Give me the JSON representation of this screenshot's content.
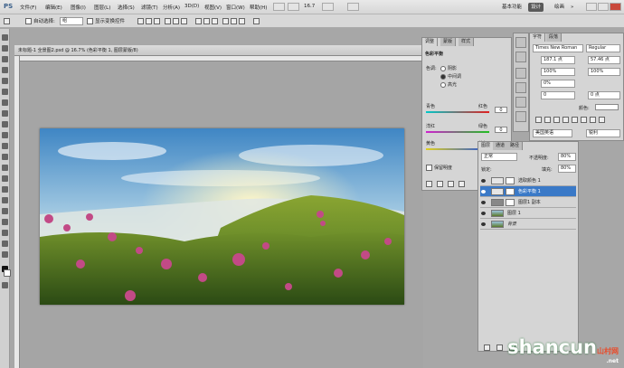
{
  "app": {
    "logo": "PS"
  },
  "menu": [
    "文件(F)",
    "编辑(E)",
    "图像(I)",
    "图层(L)",
    "选择(S)",
    "滤镜(T)",
    "分析(A)",
    "3D(D)",
    "视图(V)",
    "窗口(W)",
    "帮助(H)"
  ],
  "zoom_menu": "16.7",
  "workspace": {
    "items": [
      "基本功能",
      "设计",
      "绘画"
    ],
    "active": "设计",
    "more": "»"
  },
  "options": {
    "auto_select_label": "自动选择:",
    "auto_select_value": "组",
    "show_transform_label": "显示变换控件"
  },
  "document": {
    "tab_title": "未标题-1 全景图2.psd @ 16.7% (色彩平衡 1, 图层蒙版/8)"
  },
  "adjust_panel": {
    "tabs": [
      "调整",
      "蒙版",
      "样式"
    ],
    "title": "色彩平衡",
    "tone_label": "色调:",
    "tones": [
      "阴影",
      "中间调",
      "高光"
    ],
    "active_tone": "中间调",
    "sliders": [
      {
        "left": "青色",
        "right": "红色",
        "value": "0"
      },
      {
        "left": "洋红",
        "right": "绿色",
        "value": "0"
      },
      {
        "left": "黄色",
        "right": "蓝色",
        "value": "0"
      }
    ],
    "preserve_label": "保留明度"
  },
  "char_panel": {
    "tabs": [
      "字符",
      "段落"
    ],
    "font": "Times New Roman",
    "style": "Regular",
    "size": "187.1 点",
    "leading": "57.46 点",
    "scale_v": "100%",
    "scale_h": "100%",
    "tracking": "0%",
    "kerning": "0",
    "baseline": "0 点",
    "color_label": "颜色:",
    "lang": "美国英语",
    "aa": "锐利"
  },
  "layers_panel": {
    "tabs": [
      "图层",
      "通道",
      "路径"
    ],
    "mode": "正常",
    "opacity_label": "不透明度:",
    "opacity": "80%",
    "lock_label": "锁定:",
    "fill_label": "填充:",
    "fill": "80%",
    "layers": [
      {
        "name": "选取颜色 1",
        "selected": false
      },
      {
        "name": "色彩平衡 1",
        "selected": true
      },
      {
        "name": "图层1 副本",
        "selected": false
      },
      {
        "name": "图层 1",
        "selected": false
      },
      {
        "name": "背景",
        "selected": false
      }
    ]
  },
  "watermark": {
    "text": "shancun",
    "suffix": "山村网",
    "domain": ".net"
  }
}
